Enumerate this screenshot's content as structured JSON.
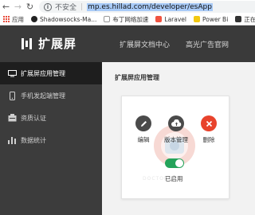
{
  "browser": {
    "insecure_label": "不安全",
    "separator": "|",
    "url": "mp.es.hillad.com/developer/esApp"
  },
  "bookmarks": [
    {
      "label": "应用",
      "icon": "apps-grid-icon",
      "color": "#e74c3c"
    },
    {
      "label": "Shadowsocks-Ma...",
      "icon": "github-icon",
      "color": "#222222"
    },
    {
      "label": "布丁网络加速",
      "icon": "page-icon",
      "color": "#4a90d9"
    },
    {
      "label": "Laravel",
      "icon": "laravel-icon",
      "color": "#f05340"
    },
    {
      "label": "Power Bi",
      "icon": "powerbi-icon",
      "color": "#f2c811"
    },
    {
      "label": "正在播放",
      "icon": "media-icon",
      "color": "#333333"
    }
  ],
  "header": {
    "logo_text": "扩展屏",
    "nav": [
      "扩展屏文档中心",
      "高光广告官网"
    ]
  },
  "sidebar": {
    "items": [
      {
        "label": "扩展屏应用管理",
        "icon": "monitor-icon",
        "active": true
      },
      {
        "label": "手机发起端管理",
        "icon": "phone-icon",
        "active": false
      },
      {
        "label": "资质认证",
        "icon": "certificate-icon",
        "active": false
      },
      {
        "label": "数据统计",
        "icon": "bar-chart-icon",
        "active": false
      }
    ]
  },
  "main": {
    "title": "扩展屏应用管理",
    "card": {
      "watermark_text": "DOCTOR",
      "actions": [
        {
          "label": "编辑",
          "icon": "pencil-icon",
          "color": "#4a4a4a"
        },
        {
          "label": "版本管理",
          "icon": "cloud-upload-icon",
          "color": "#4a4a4a"
        },
        {
          "label": "删除",
          "icon": "close-icon",
          "color": "#e8432c"
        }
      ],
      "toggle_on": true,
      "toggle_color": "#25a35a",
      "status_label": "已启用"
    }
  }
}
